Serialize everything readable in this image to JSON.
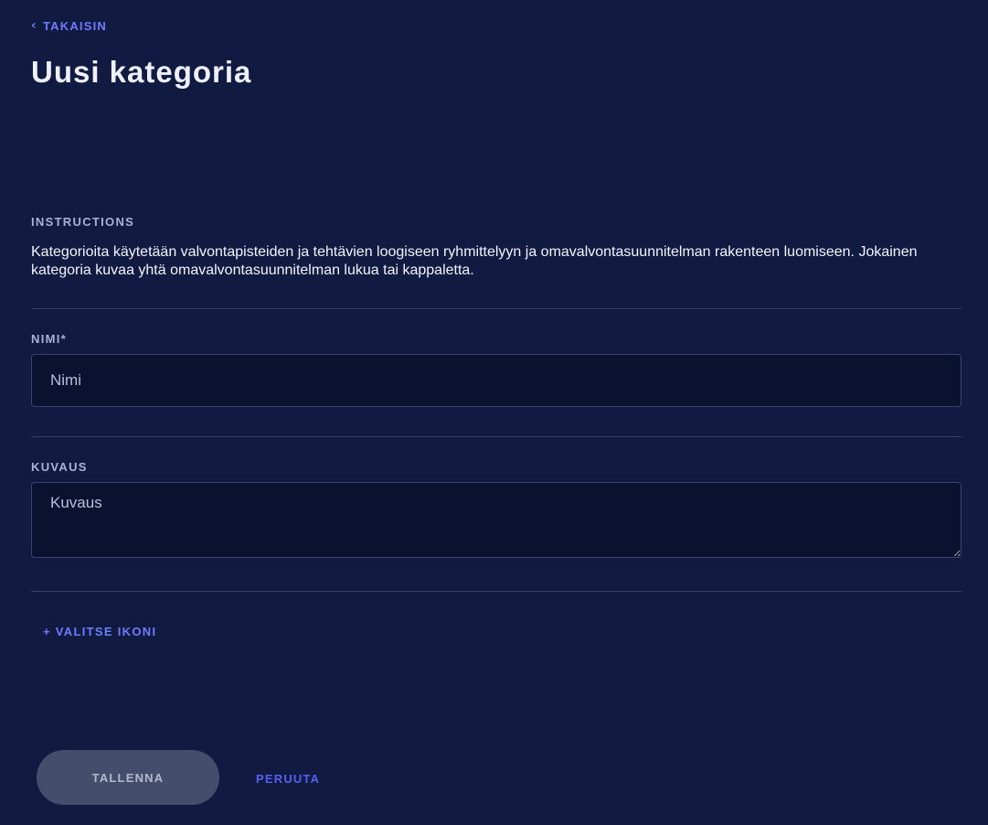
{
  "header": {
    "back_icon": "chevron-left-icon",
    "back_label": "TAKAISIN",
    "title": "Uusi kategoria"
  },
  "instructions": {
    "label": "INSTRUCTIONS",
    "text": "Kategorioita käytetään valvontapisteiden ja tehtävien loogiseen ryhmittelyyn ja omavalvontasuunnitelman rakenteen luomiseen. Jokainen kategoria kuvaa yhtä omavalvontasuunnitelman lukua tai kappaletta."
  },
  "form": {
    "name": {
      "label": "NIMI*",
      "placeholder": "Nimi",
      "value": ""
    },
    "description": {
      "label": "KUVAUS",
      "placeholder": "Kuvaus",
      "value": ""
    },
    "choose_icon_label": "+ VALITSE IKONI"
  },
  "actions": {
    "save_label": "TALLENNA",
    "cancel_label": "PERUUTA"
  },
  "colors": {
    "background": "#111a40",
    "accent": "#6f7cff",
    "save_button_bg": "#454d6d"
  }
}
